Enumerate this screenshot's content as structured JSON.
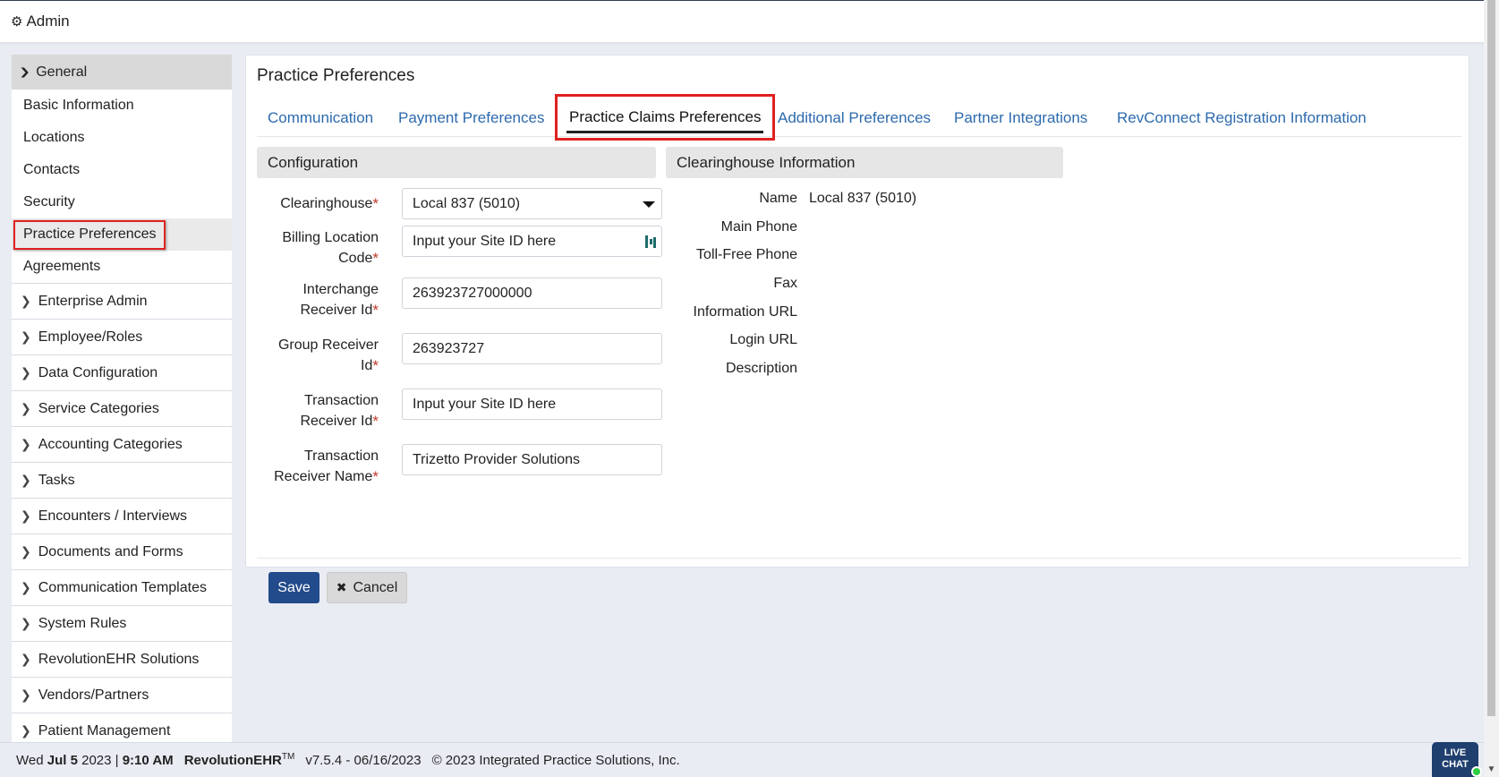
{
  "topbar": {
    "title": "Admin",
    "icon": "gears-icon"
  },
  "sidebar": {
    "group_header": "General",
    "sub_items": [
      "Basic Information",
      "Locations",
      "Contacts",
      "Security",
      "Practice Preferences",
      "Agreements"
    ],
    "active_item": "Practice Preferences",
    "groups": [
      "Enterprise Admin",
      "Employee/Roles",
      "Data Configuration",
      "Service Categories",
      "Accounting Categories",
      "Tasks",
      "Encounters / Interviews",
      "Documents and Forms",
      "Communication Templates",
      "System Rules",
      "RevolutionEHR Solutions",
      "Vendors/Partners",
      "Patient Management"
    ]
  },
  "main": {
    "title": "Practice Preferences",
    "tabs": [
      "Communication",
      "Payment Preferences",
      "Practice Claims Preferences",
      "Additional Preferences",
      "Partner Integrations",
      "RevConnect Registration Information"
    ],
    "active_tab": "Practice Claims Preferences",
    "configuration": {
      "header": "Configuration",
      "clearinghouse_label": "Clearinghouse",
      "clearinghouse_value": "Local 837 (5010)",
      "billing_location_label": "Billing Location Code",
      "billing_location_value": "Input your Site ID here",
      "interchange_label": "Interchange Receiver Id",
      "interchange_value": "263923727000000",
      "group_receiver_label": "Group Receiver Id",
      "group_receiver_value": "263923727",
      "transaction_receiver_id_label": "Transaction Receiver Id",
      "transaction_receiver_id_value": "Input your Site ID here",
      "transaction_receiver_name_label": "Transaction Receiver Name",
      "transaction_receiver_name_value": "Trizetto Provider Solutions"
    },
    "clearinghouse_info": {
      "header": "Clearinghouse Information",
      "name_label": "Name",
      "name_value": "Local 837 (5010)",
      "main_phone_label": "Main Phone",
      "toll_free_label": "Toll-Free Phone",
      "fax_label": "Fax",
      "info_url_label": "Information URL",
      "login_url_label": "Login URL",
      "description_label": "Description"
    },
    "save_label": "Save",
    "cancel_label": "Cancel"
  },
  "footer": {
    "day": "Wed",
    "date_bold": "Jul 5",
    "year": "2023",
    "time": "9:10 AM",
    "brand": "RevolutionEHR",
    "tm": "TM",
    "version": "v7.5.4 - 06/16/2023",
    "copyright": "© 2023 Integrated Practice Solutions, Inc."
  },
  "livechat": {
    "line1": "LIVE",
    "line2": "CHAT"
  },
  "colors": {
    "accent": "#224b8b",
    "link": "#2d6aad",
    "highlight": "#e02020"
  }
}
